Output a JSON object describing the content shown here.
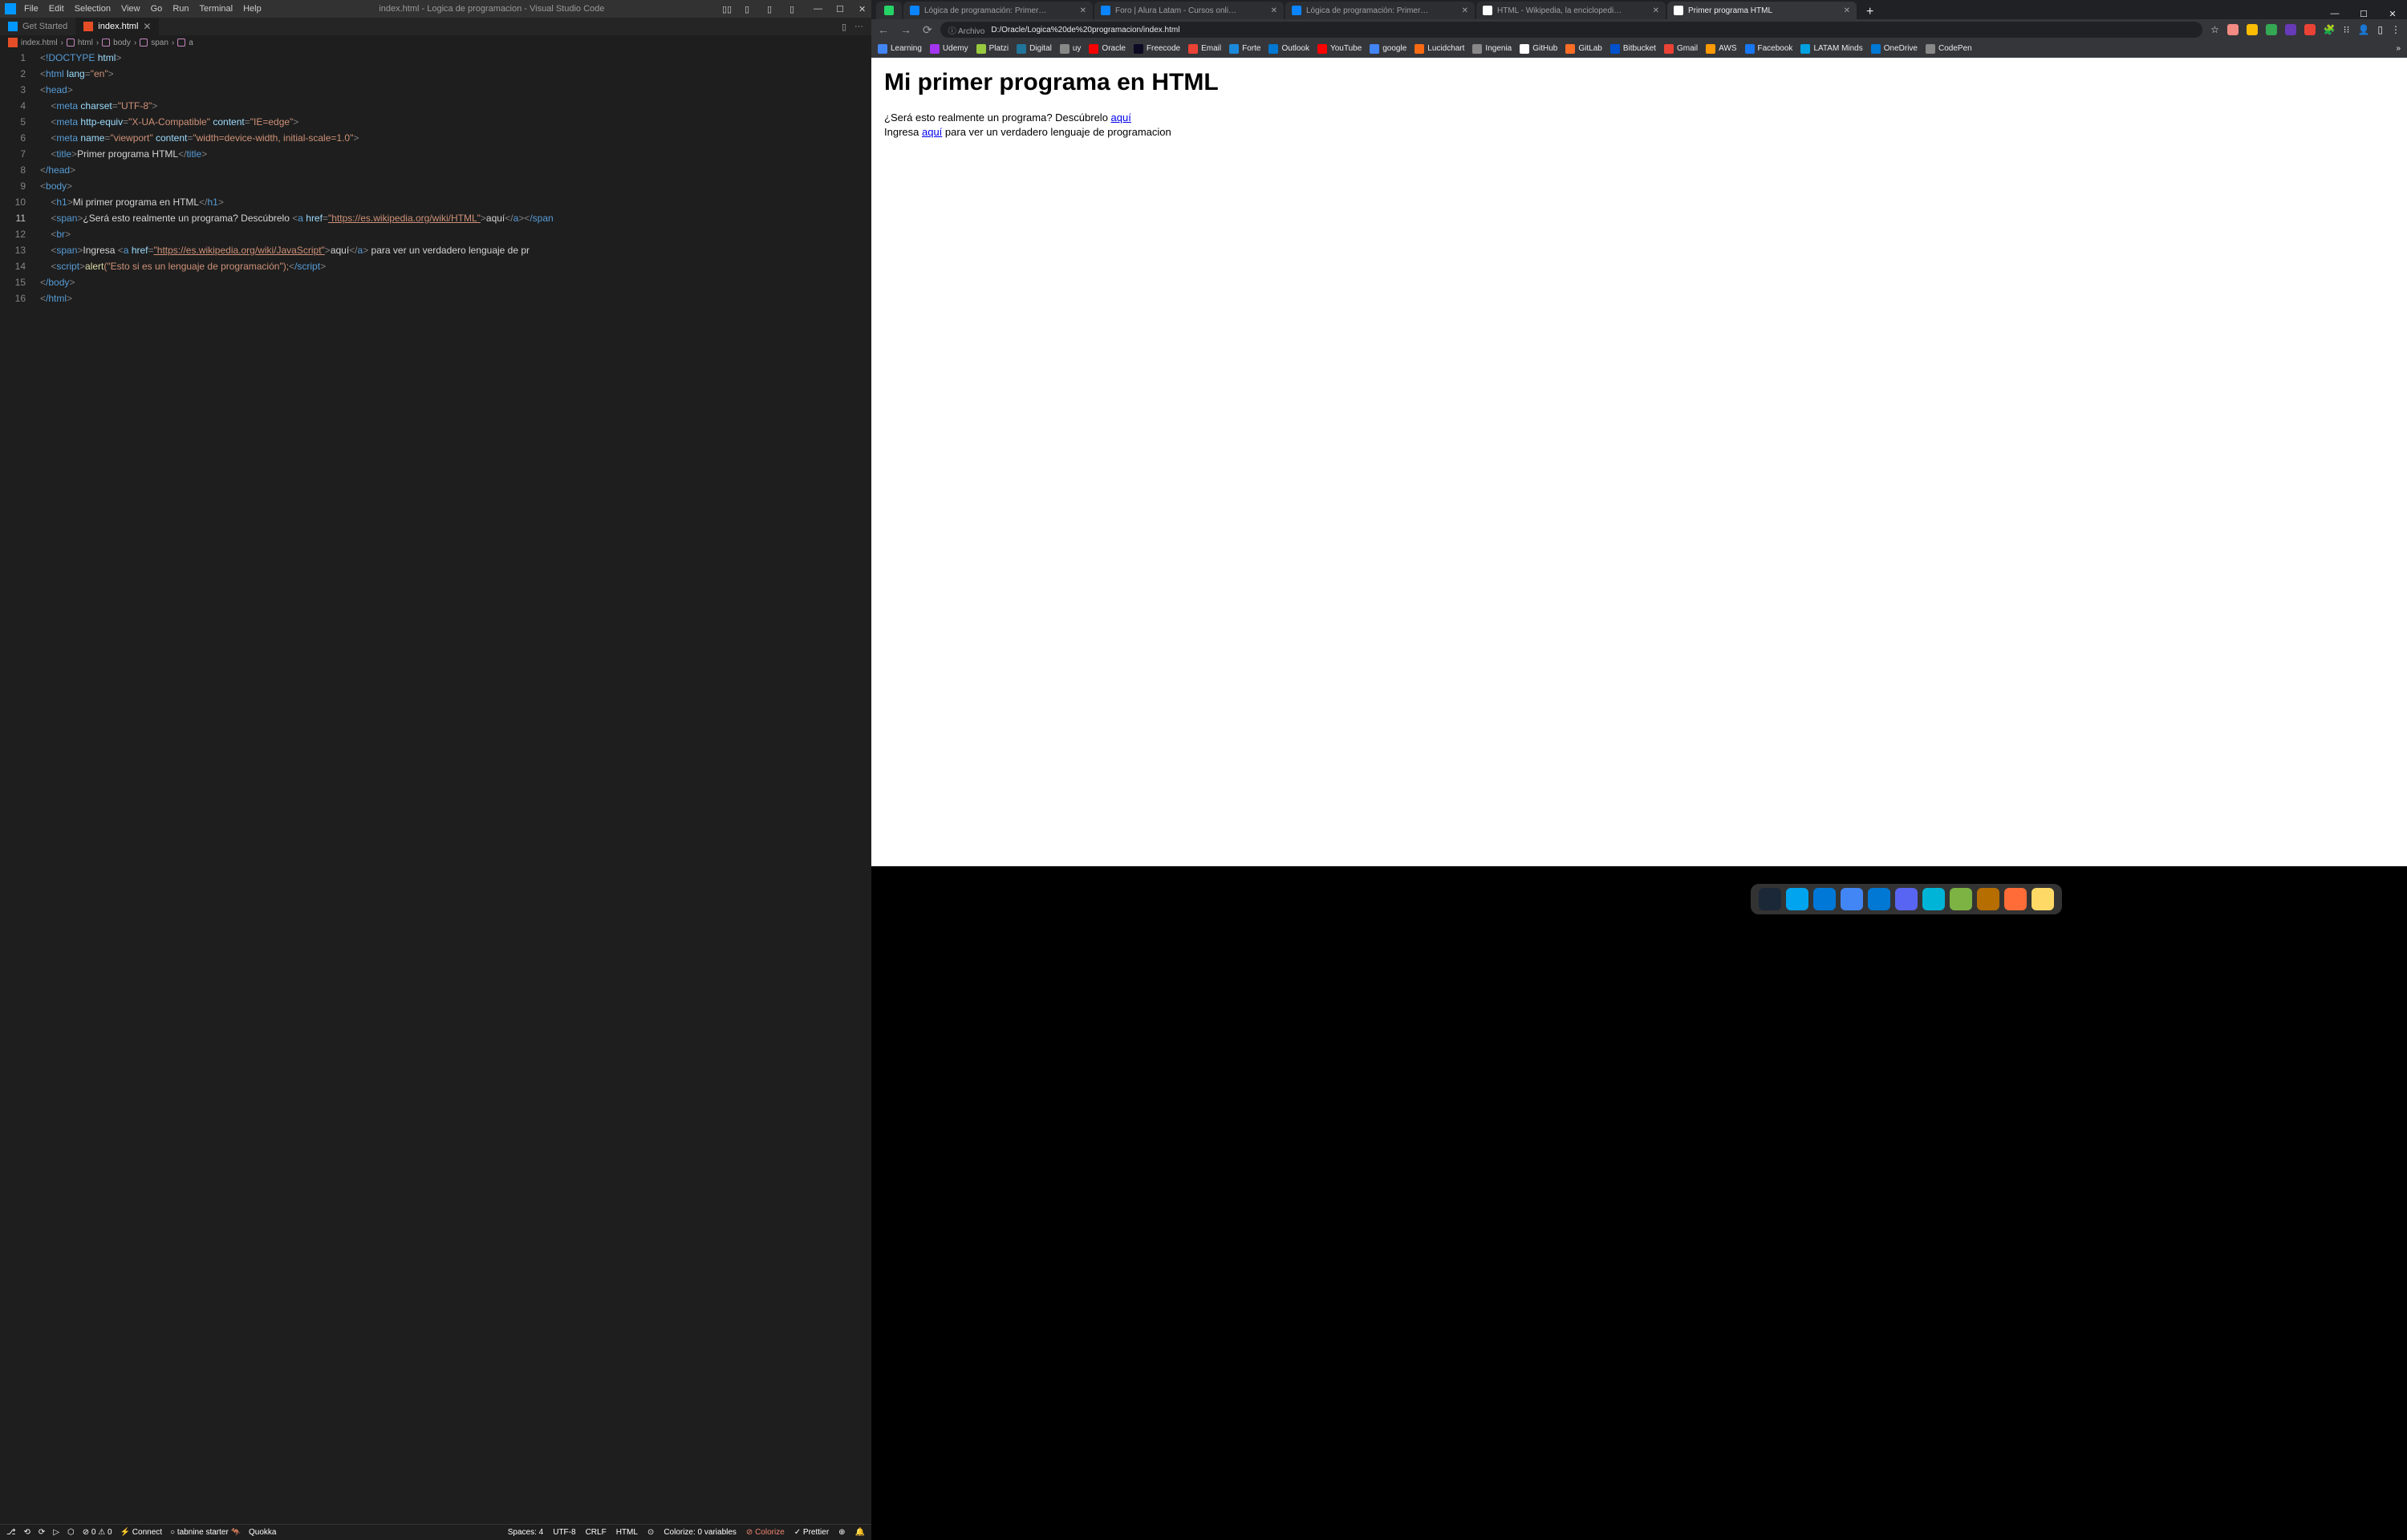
{
  "vscode": {
    "menu": [
      "File",
      "Edit",
      "Selection",
      "View",
      "Go",
      "Run",
      "Terminal",
      "Help"
    ],
    "title": "index.html - Logica de programacion - Visual Studio Code",
    "layout_icons": [
      "▯▯",
      "▯",
      "▯",
      "▯"
    ],
    "window_icons": [
      "—",
      "☐",
      "✕"
    ],
    "tabs": [
      {
        "icon": "vscode",
        "label": "Get Started",
        "active": false
      },
      {
        "icon": "html",
        "label": "index.html",
        "active": true
      }
    ],
    "tab_actions": [
      "▯",
      "···"
    ],
    "breadcrumb": [
      {
        "icon": "html",
        "label": "index.html"
      },
      {
        "icon": "sym",
        "label": "html"
      },
      {
        "icon": "sym",
        "label": "body"
      },
      {
        "icon": "sym",
        "label": "span"
      },
      {
        "icon": "sym",
        "label": "a"
      }
    ],
    "gutter": [
      "1",
      "2",
      "3",
      "4",
      "5",
      "6",
      "7",
      "8",
      "9",
      "10",
      "11",
      "12",
      "13",
      "14",
      "15",
      "16"
    ],
    "highlighted_line": 11,
    "code": {
      "l1": "!DOCTYPE",
      "l1b": "html",
      "l2": "html",
      "l2a": "lang",
      "l2v": "\"en\"",
      "l3": "head",
      "l4": "meta",
      "l4a": "charset",
      "l4v": "\"UTF-8\"",
      "l5": "meta",
      "l5a": "http-equiv",
      "l5v": "\"X-UA-Compatible\"",
      "l5a2": "content",
      "l5v2": "\"IE=edge\"",
      "l6": "meta",
      "l6a": "name",
      "l6v": "\"viewport\"",
      "l6a2": "content",
      "l6v2": "\"width=device-width, initial-scale=1.0\"",
      "l7": "title",
      "l7t": "Primer programa HTML",
      "l8": "/head",
      "l9": "body",
      "l10": "h1",
      "l10t": "Mi primer programa en HTML",
      "l11": "span",
      "l11t": "¿Será esto realmente un programa? Descúbrelo ",
      "l11a": "a",
      "l11h": "href",
      "l11u": "\"https://es.wikipedia.org/wiki/HTML\"",
      "l11t2": "aquí",
      "l11e": "/span",
      "l12": "br",
      "l13": "span",
      "l13t": "Ingresa ",
      "l13a": "a",
      "l13h": "href",
      "l13u": "\"https://es.wikipedia.org/wiki/JavaScript\"",
      "l13t2": "aquí",
      "l13t3": " para ver un verdadero lenguaje de pr",
      "l14": "script",
      "l14f": "alert",
      "l14s": "(\"Esto si es un lenguaje de programación\");",
      "l14e": "/script",
      "l15": "/body",
      "l16": "/html"
    },
    "status": {
      "left": [
        "⎇",
        "⟲",
        "⟳",
        "▷",
        "⬡",
        "⊘ 0 ⚠ 0",
        "⚡ Connect",
        "○ tabnine starter 🦘",
        "Quokka"
      ],
      "right": [
        "Spaces: 4",
        "UTF-8",
        "CRLF",
        "HTML",
        "⊙",
        "Colorize: 0 variables",
        "⊘ Colorize",
        "✓ Prettier",
        "⊕",
        "🔔"
      ]
    }
  },
  "chrome": {
    "tabs": [
      {
        "icon": "#25d366",
        "label": "",
        "narrow": true
      },
      {
        "icon": "#0a84ff",
        "label": "Lógica de programación: Primer…"
      },
      {
        "icon": "#0a84ff",
        "label": "Foro | Alura Latam - Cursos onli…"
      },
      {
        "icon": "#0a84ff",
        "label": "Lógica de programación: Primer…"
      },
      {
        "icon": "#ffffff",
        "label": "HTML - Wikipedia, la enciclopedi…"
      },
      {
        "icon": "#ffffff",
        "label": "Primer programa HTML",
        "active": true
      }
    ],
    "window_icons": [
      "—",
      "☐",
      "✕"
    ],
    "nav": [
      "←",
      "→",
      "⟳"
    ],
    "secure": "ⓘ Archivo",
    "url": "D:/Oracle/Logica%20de%20programacion/index.html",
    "addr_icons": [
      "☆",
      "#f28b82",
      "#fbbc04",
      "#34a853",
      "#673ab7",
      "#ea4335",
      "🧩",
      "⁝⁝",
      "👤",
      "▯",
      "⋮"
    ],
    "bookmarks": [
      {
        "c": "#4285f4",
        "l": "Learning"
      },
      {
        "c": "#a435f0",
        "l": "Udemy"
      },
      {
        "c": "#98ca3f",
        "l": "Platzi"
      },
      {
        "c": "#21759b",
        "l": "Digital"
      },
      {
        "c": "#888",
        "l": "uy"
      },
      {
        "c": "#f80000",
        "l": "Oracle"
      },
      {
        "c": "#0a0a23",
        "l": "Freecode"
      },
      {
        "c": "#ea4335",
        "l": "Email"
      },
      {
        "c": "#1c8adb",
        "l": "Forte"
      },
      {
        "c": "#0078d4",
        "l": "Outlook"
      },
      {
        "c": "#ff0000",
        "l": "YouTube"
      },
      {
        "c": "#4285f4",
        "l": "google"
      },
      {
        "c": "#f96b13",
        "l": "Lucidchart"
      },
      {
        "c": "#888",
        "l": "Ingenia"
      },
      {
        "c": "#fff",
        "l": "GitHub"
      },
      {
        "c": "#fc6d26",
        "l": "GitLab"
      },
      {
        "c": "#0052cc",
        "l": "Bitbucket"
      },
      {
        "c": "#ea4335",
        "l": "Gmail"
      },
      {
        "c": "#ff9900",
        "l": "AWS"
      },
      {
        "c": "#1877f2",
        "l": "Facebook"
      },
      {
        "c": "#00a1e0",
        "l": "LATAM Minds"
      },
      {
        "c": "#0078d4",
        "l": "OneDrive"
      },
      {
        "c": "#888",
        "l": "CodePen"
      }
    ],
    "bookmarks_overflow": "»",
    "page": {
      "h1": "Mi primer programa en HTML",
      "p1a": "¿Será esto realmente un programa? Descúbrelo ",
      "p1link": "aquí",
      "p2a": "Ingresa ",
      "p2link": "aquí",
      "p2b": " para ver un verdadero lenguaje de programacion"
    }
  },
  "dock": [
    "#1b2838",
    "#00a4ef",
    "#0078d7",
    "#4285f4",
    "#0078d4",
    "#5865f2",
    "#00b4d8",
    "#7cb342",
    "#b76e00",
    "#ff6c37",
    "#ffd966"
  ]
}
